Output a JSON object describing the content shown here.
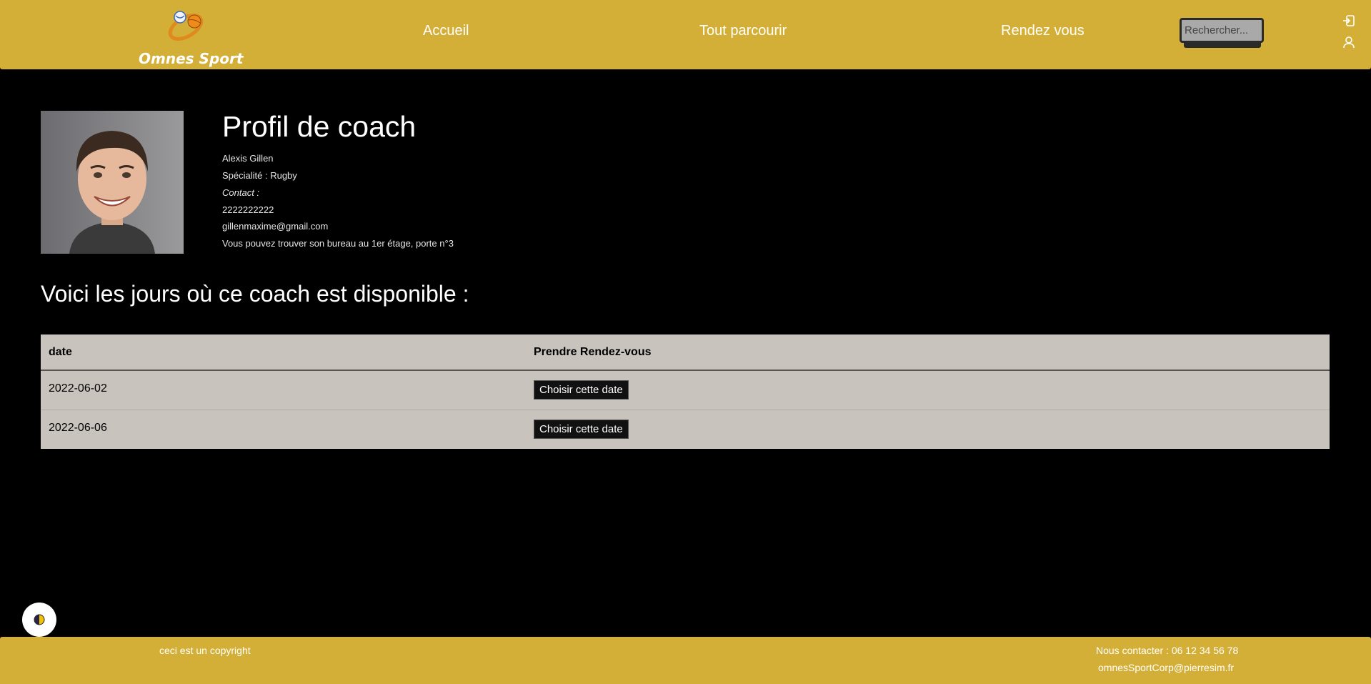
{
  "header": {
    "logo_text": "Omnes Sport",
    "nav": {
      "home": "Accueil",
      "browse": "Tout parcourir",
      "appointments": "Rendez vous"
    },
    "search": {
      "placeholder": "Rechercher..."
    },
    "icons": [
      "login-icon",
      "user-icon"
    ]
  },
  "profile": {
    "title": "Profil de coach",
    "name": "Alexis Gillen",
    "specialty": "Spécialité : Rugby",
    "contact_label": "Contact :",
    "phone": "2222222222",
    "email": "gillenmaxime@gmail.com",
    "office": "Vous pouvez trouver son bureau au 1er étage, porte n°3"
  },
  "availability": {
    "title": "Voici les jours où ce coach est disponible :",
    "columns": [
      "date",
      "Prendre Rendez-vous"
    ],
    "rows": [
      {
        "date": "2022-06-02",
        "action": "Choisir cette date"
      },
      {
        "date": "2022-06-06",
        "action": "Choisir cette date"
      }
    ]
  },
  "footer": {
    "copyright": "ceci est un copyright",
    "contact_phone": "Nous contacter : 06 12 34 56 78",
    "contact_email": "omnesSportCorp@pierresim.fr"
  },
  "colors": {
    "brand": "#d4af37",
    "background": "#000000",
    "table": "#c8c3bd"
  }
}
